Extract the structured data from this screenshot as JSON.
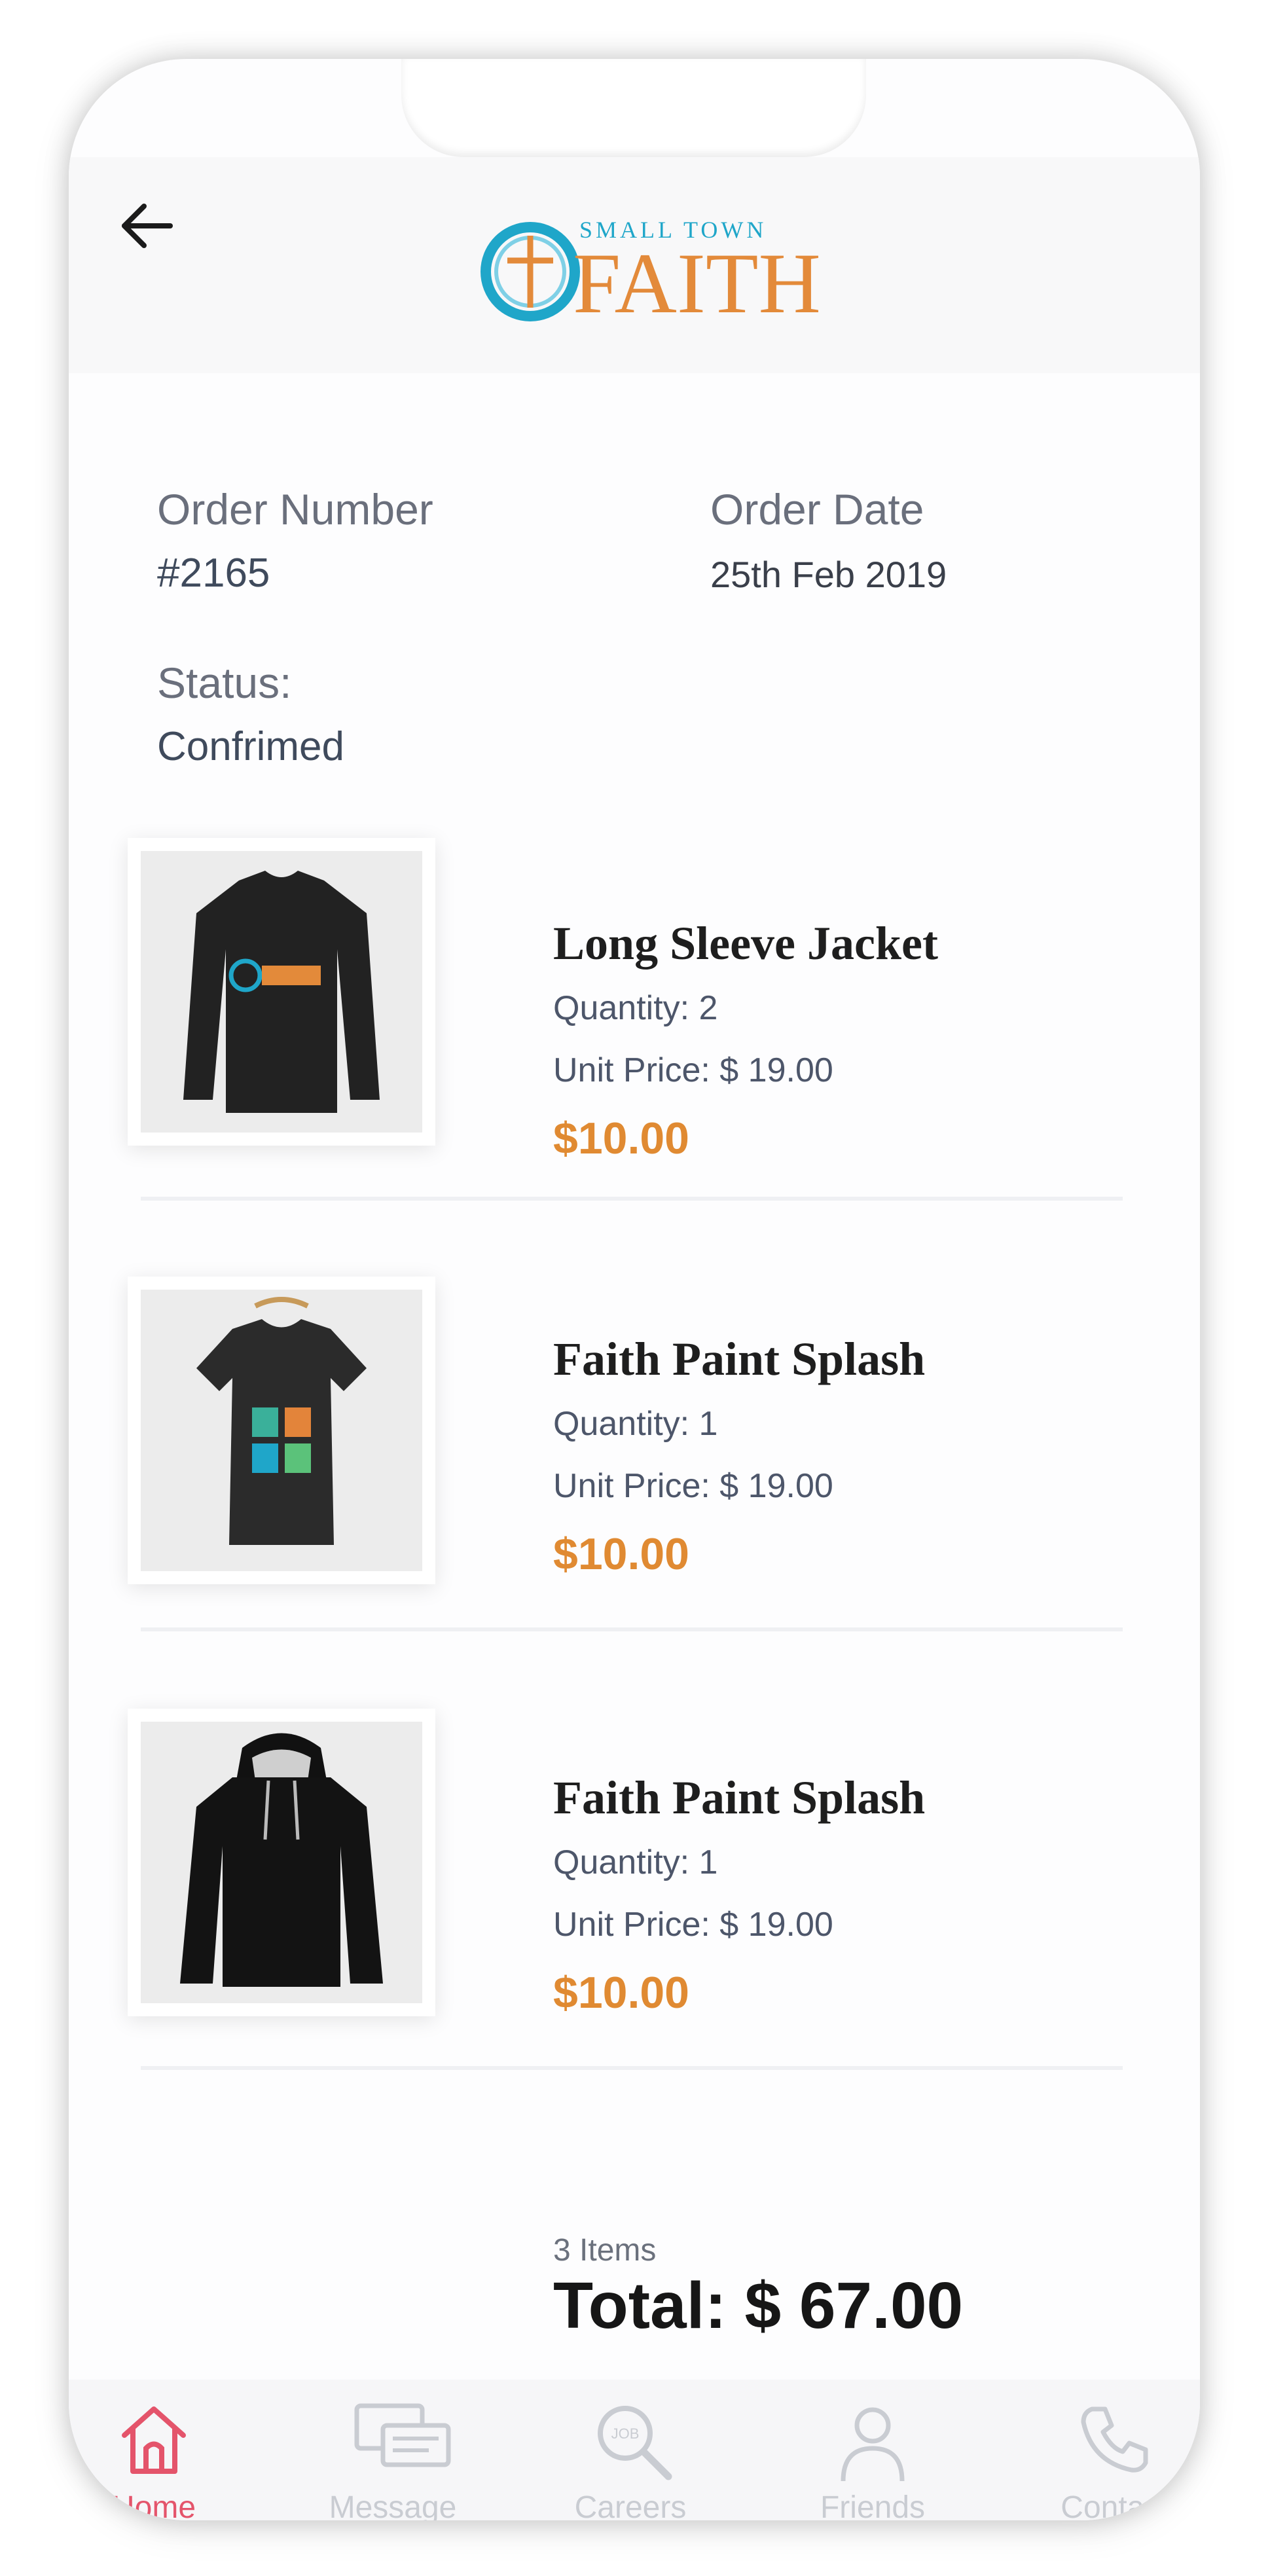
{
  "header": {
    "back_icon": "arrow-left-icon",
    "logo_top": "SMALL TOWN",
    "logo_main": "FAITH"
  },
  "order": {
    "number_label": "Order Number",
    "number_value": "#2165",
    "date_label": "Order Date",
    "date_value": "25th Feb 2019",
    "status_label": "Status:",
    "status_value": "Confrimed"
  },
  "items": [
    {
      "name": "Long Sleeve Jacket",
      "quantity": "Quantity: 2",
      "unit_price": "Unit Price: $ 19.00",
      "price": "$10.00",
      "image": "long-sleeve-shirt"
    },
    {
      "name": "Faith Paint Splash",
      "quantity": "Quantity: 1",
      "unit_price": "Unit Price: $ 19.00",
      "price": "$10.00",
      "image": "tshirt"
    },
    {
      "name": "Faith Paint Splash",
      "quantity": "Quantity: 1",
      "unit_price": "Unit Price: $ 19.00",
      "price": "$10.00",
      "image": "hoodie"
    }
  ],
  "summary": {
    "count": "3 Items",
    "total": "Total: $ 67.00"
  },
  "tabs": [
    {
      "label": "Home",
      "icon": "home-icon",
      "active": true
    },
    {
      "label": "Message",
      "icon": "message-icon",
      "active": false
    },
    {
      "label": "Careers",
      "icon": "careers-icon",
      "active": false
    },
    {
      "label": "Friends",
      "icon": "friends-icon",
      "active": false
    },
    {
      "label": "Contact",
      "icon": "phone-icon",
      "active": false
    }
  ],
  "colors": {
    "accent": "#e08a32",
    "active_tab": "#e4546b",
    "logo_blue": "#1fa6c9"
  }
}
